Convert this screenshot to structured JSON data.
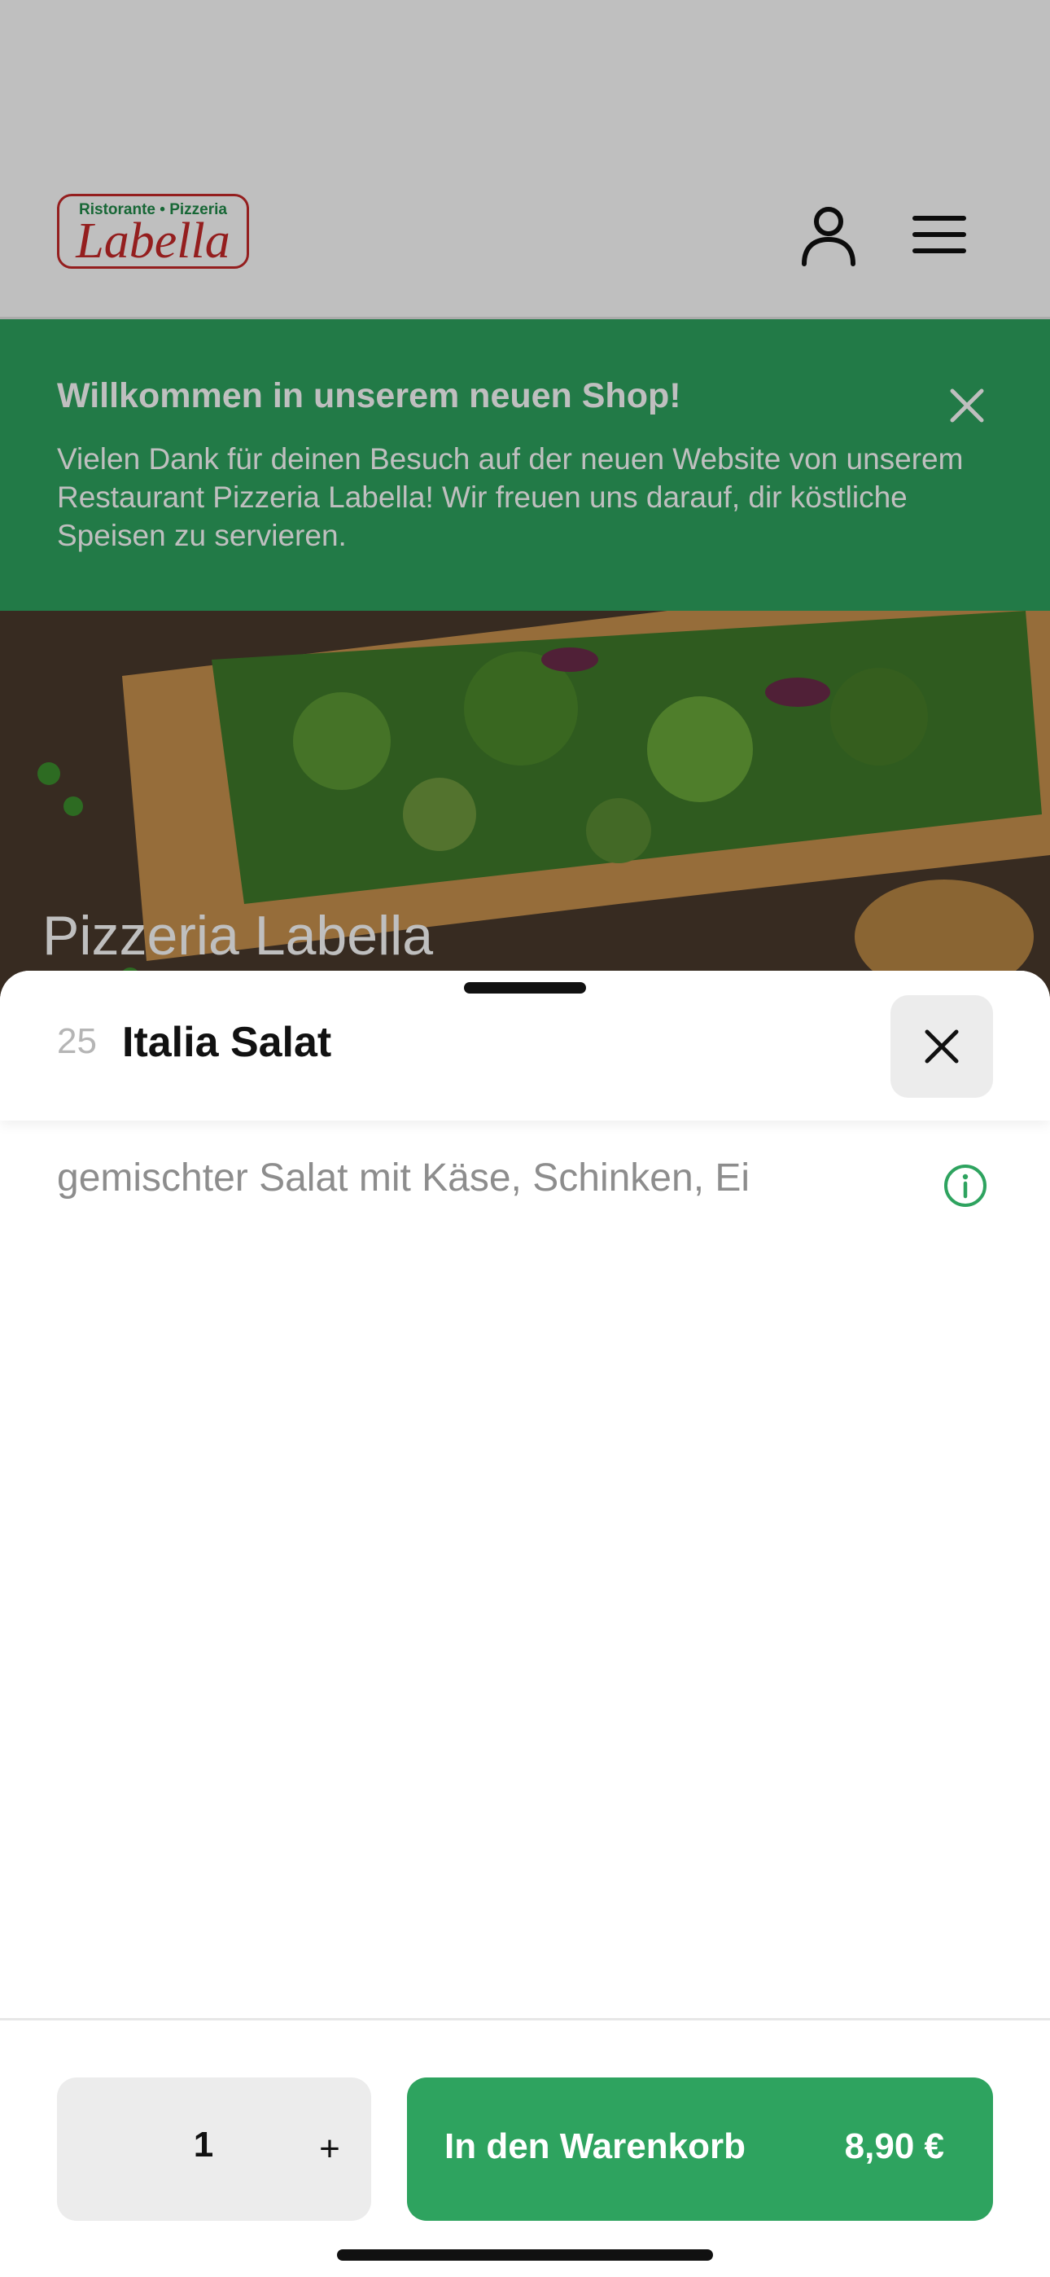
{
  "header": {
    "logo_top": "Ristorante • Pizzeria",
    "logo_main": "Labella",
    "user_icon": "user-icon",
    "menu_icon": "hamburger-menu-icon"
  },
  "banner": {
    "title": "Willkommen in unserem neuen Shop!",
    "text": "Vielen Dank für deinen Besuch auf der neuen Website von unserem Restaurant Pizzeria Labella! Wir freuen uns darauf, dir köstliche Speisen zu servieren.",
    "close_icon": "close-icon"
  },
  "hero": {
    "title": "Pizzeria Labella"
  },
  "item": {
    "number": "25",
    "title": "Italia Salat",
    "description": "gemischter Salat mit Käse, Schinken, Ei",
    "info_icon": "info-icon",
    "close_icon": "close-icon"
  },
  "footer": {
    "quantity": "1",
    "plus": "+",
    "cart_label": "In den Warenkorb",
    "price": "8,90 €"
  },
  "colors": {
    "brand_green": "#2ea35f",
    "brand_red": "#c62828"
  }
}
